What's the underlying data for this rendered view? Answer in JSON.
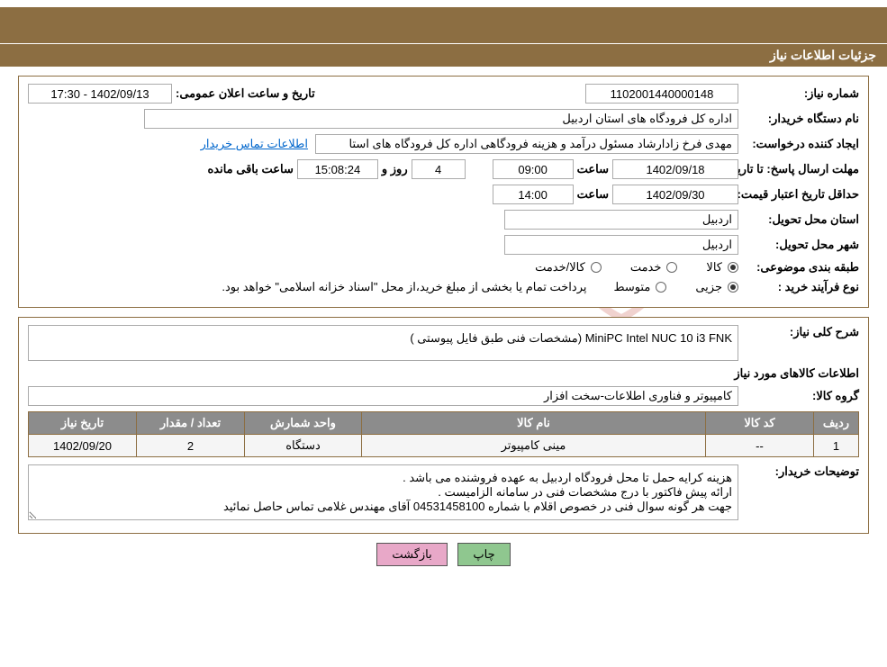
{
  "header": {
    "title": "جزئیات اطلاعات نیاز"
  },
  "labels": {
    "need_number": "شماره نیاز:",
    "public_announce": "تاریخ و ساعت اعلان عمومی:",
    "buyer_org": "نام دستگاه خریدار:",
    "requester": "ایجاد کننده درخواست:",
    "buyer_contact_link": "اطلاعات تماس خریدار",
    "reply_deadline": "مهلت ارسال پاسخ:",
    "until_date": "تا تاریخ:",
    "hour": "ساعت",
    "days_and": "روز و",
    "hours_remaining": "ساعت باقی مانده",
    "price_validity": "حداقل تاریخ اعتبار قیمت:",
    "delivery_province": "استان محل تحویل:",
    "delivery_city": "شهر محل تحویل:",
    "subject_class": "طبقه بندی موضوعی:",
    "goods_opt": "کالا",
    "service_opt": "خدمت",
    "goods_service_opt": "کالا/خدمت",
    "purchase_type": "نوع فرآیند خرید :",
    "partial_opt": "جزیی",
    "medium_opt": "متوسط",
    "payment_note": "پرداخت تمام یا بخشی از مبلغ خرید،از محل \"اسناد خزانه اسلامی\" خواهد بود.",
    "overall_desc": "شرح کلی نیاز:",
    "items_info": "اطلاعات کالاهای مورد نیاز",
    "goods_group": "گروه کالا:",
    "buyer_notes": "توضیحات خریدار:"
  },
  "values": {
    "need_number": "1102001440000148",
    "public_announce": "1402/09/13 - 17:30",
    "buyer_org": "اداره کل فرودگاه های استان اردبیل",
    "requester": "مهدی فرخ زادارشاد مسئول درآمد و هزینه فرودگاهی اداره کل فرودگاه های استا",
    "reply_date": "1402/09/18",
    "reply_time": "09:00",
    "days_left": "4",
    "time_left": "15:08:24",
    "price_date": "1402/09/30",
    "price_time": "14:00",
    "delivery_province": "اردبیل",
    "delivery_city": "اردبیل",
    "overall_desc": "MiniPC   Intel NUC 10 i3 FNK  (مشخصات فنی طبق فایل پیوستی )",
    "goods_group": "کامپیوتر و فناوری اطلاعات-سخت افزار",
    "buyer_notes": "هزینه کرایه حمل تا محل فرودگاه اردبیل به عهده فروشنده می باشد .\nارائه پیش فاکتور با درج مشخصات فنی در سامانه الزامیست .\nجهت هر گونه سوال فنی در خصوص اقلام با شماره 04531458100 آقای مهندس غلامی تماس حاصل نمائید"
  },
  "table": {
    "headers": {
      "row": "ردیف",
      "code": "کد کالا",
      "name": "نام کالا",
      "unit": "واحد شمارش",
      "qty": "تعداد / مقدار",
      "need_date": "تاریخ نیاز"
    },
    "rows": [
      {
        "row": "1",
        "code": "--",
        "name": "مینی کامپیوتر",
        "unit": "دستگاه",
        "qty": "2",
        "need_date": "1402/09/20"
      }
    ]
  },
  "buttons": {
    "print": "چاپ",
    "back": "بازگشت"
  },
  "watermark": {
    "text": "AriaTender.net"
  }
}
